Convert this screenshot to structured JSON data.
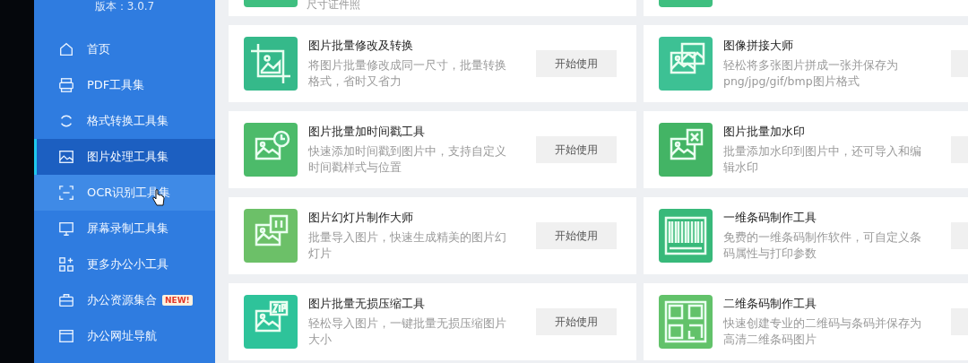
{
  "sidebar": {
    "version": "版本：3.0.7",
    "items": [
      {
        "kind": "home",
        "label": "首页",
        "selected": false,
        "hovered": false
      },
      {
        "kind": "pdf",
        "label": "PDF工具集",
        "selected": false,
        "hovered": false
      },
      {
        "kind": "convert",
        "label": "格式转换工具集",
        "selected": false,
        "hovered": false
      },
      {
        "kind": "image",
        "label": "图片处理工具集",
        "selected": true,
        "hovered": false
      },
      {
        "kind": "ocr",
        "label": "OCR识别工具集",
        "selected": false,
        "hovered": true
      },
      {
        "kind": "screen",
        "label": "屏幕录制工具集",
        "selected": false,
        "hovered": false
      },
      {
        "kind": "apps",
        "label": "更多办公小工具",
        "selected": false,
        "hovered": false
      },
      {
        "kind": "briefcase",
        "label": "办公资源集合",
        "badge": "NEW!",
        "selected": false,
        "hovered": false
      },
      {
        "kind": "browser",
        "label": "办公网址导航",
        "selected": false,
        "hovered": false
      }
    ]
  },
  "top_card": {
    "description": "尺寸证件照"
  },
  "cards": [
    {
      "kind": "crop",
      "title": "图片批量修改及转换",
      "description": "将图片批量修改成同一尺寸，批量转换格式，省时又省力",
      "button": "开始使用"
    },
    {
      "kind": "collage",
      "title": "图像拼接大师",
      "description": "轻松将多张图片拼成一张并保存为png/jpg/gif/bmp图片格式"
    },
    {
      "kind": "clock",
      "title": "图片批量加时间戳工具",
      "description": "快速添加时间戳到图片中，支持自定义时间戳样式与位置",
      "button": "开始使用"
    },
    {
      "kind": "watermark",
      "title": "图片批量加水印",
      "description": "批量添加水印到图片中，还可导入和编辑水印"
    },
    {
      "kind": "slides",
      "title": "图片幻灯片制作大师",
      "description": "批量导入图片，快速生成精美的图片幻灯片",
      "button": "开始使用"
    },
    {
      "kind": "barcode",
      "title": "一维条码制作工具",
      "description": "免费的一维条码制作软件，可自定义条码属性与打印参数"
    },
    {
      "kind": "zip",
      "title": "图片批量无损压缩工具",
      "description": "轻松导入图片，一键批量无损压缩图片大小",
      "button": "开始使用"
    },
    {
      "kind": "qrcode",
      "title": "二维条码制作工具",
      "description": "快速创建专业的二维码与条码并保存为高清二维条码图片"
    }
  ]
}
